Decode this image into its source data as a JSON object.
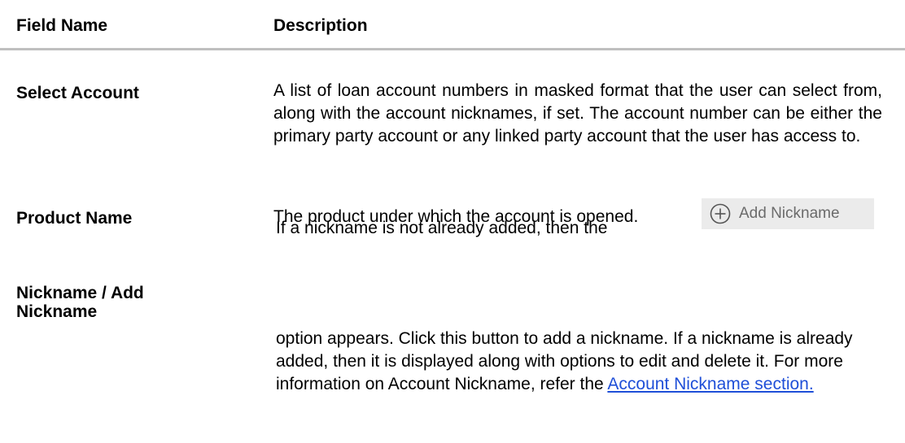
{
  "table": {
    "headers": {
      "field": "Field Name",
      "description": "Description"
    },
    "rows": [
      {
        "field": "Select Account",
        "description": "A list of loan account numbers in masked format that the user can select from, along with the account nicknames, if set. The account number can be either the primary party account or any linked party account that the user has access to."
      },
      {
        "field": "Product Name",
        "description": "The product under which the account is opened."
      },
      {
        "field_line1": "Nickname / Add",
        "field_line2": "Nickname",
        "description_line1": "If a nickname is not already added, then the",
        "add_nickname_button": {
          "label": "Add Nickname",
          "icon": "plus-circle-icon"
        },
        "description_rest": "option appears. Click this button to add a nickname. If a nickname is already added, then it is displayed along with options to edit and delete it. For more information on Account Nickname, refer the",
        "link_text": "Account Nickname section."
      }
    ]
  }
}
